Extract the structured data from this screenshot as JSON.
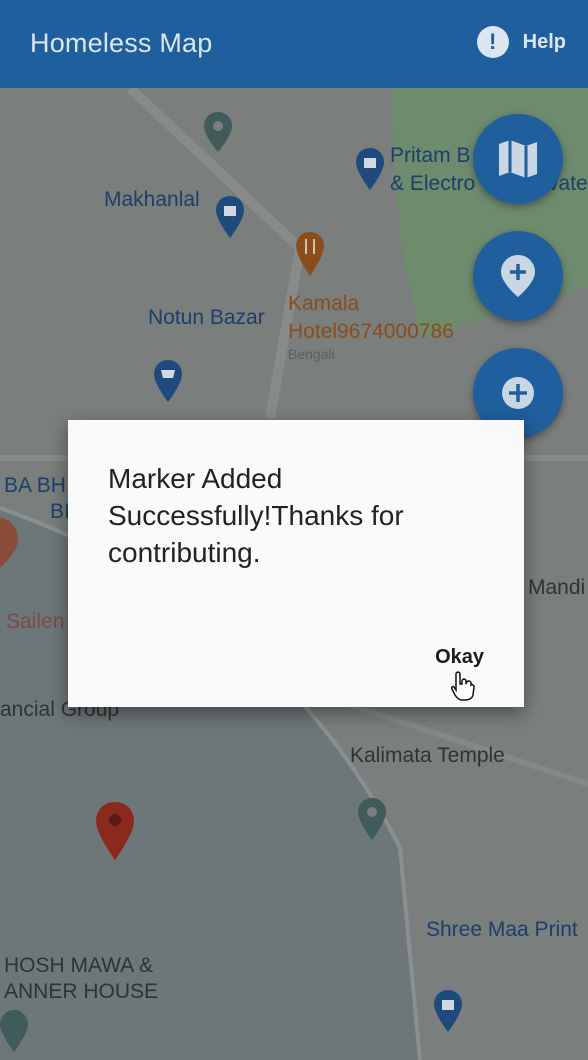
{
  "app": {
    "title": "Homeless Map",
    "help_label": "Help"
  },
  "map": {
    "labels": {
      "makhanlal": "Makhanlal",
      "pritam_line1": "Pritam B",
      "pritam_line2": "& Electro",
      "pritam_suffix": "vate",
      "notun_bazar": "Notun Bazar",
      "kamala_line1": "Kamala",
      "kamala_line2": "Hotel9674000786",
      "bengali": "Bengali",
      "ba_bh": "BA BH",
      "bi": "BI",
      "sailen": "Sailen",
      "mandi": "Mandi",
      "financial_group": "ancial Group",
      "kalimata_temple": "Kalimata Temple",
      "shree_maa": "Shree Maa Print",
      "ghosh_mawa_line1": "HOSH MAWA &",
      "ghosh_mawa_line2": "ANNER HOUSE"
    }
  },
  "dialog": {
    "message": "Marker Added Successfully!Thanks for contributing.",
    "okay_label": "Okay"
  },
  "colors": {
    "primary": "#1f5f9d",
    "marker": "#8b2a1c"
  }
}
